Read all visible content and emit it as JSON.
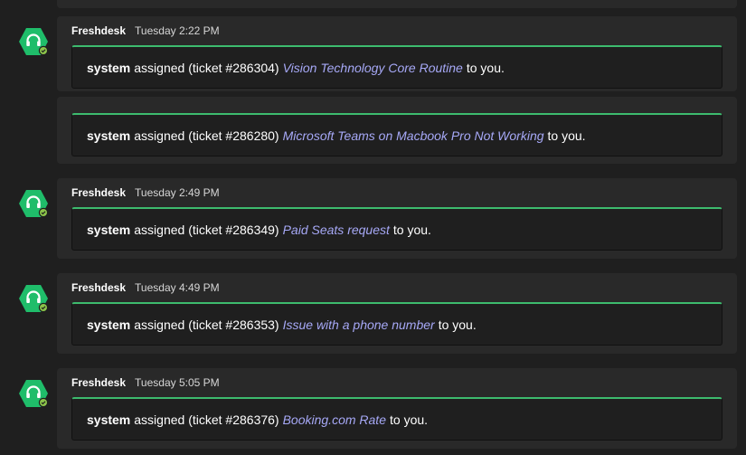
{
  "app": {
    "accent": "#3dbb6e",
    "link_color": "#a6a8f6",
    "avatar_color": "#1fbd6a"
  },
  "messages": [
    {
      "sender": "Freshdesk",
      "time": "Tuesday 2:22 PM",
      "notices": [
        {
          "actor": "system",
          "before": "assigned (ticket #286304)",
          "link": "Vision Technology Core Routine",
          "after": "to you."
        },
        {
          "actor": "system",
          "before": "assigned (ticket #286280)",
          "link": "Microsoft Teams on Macbook Pro Not Working",
          "after": "to you."
        }
      ]
    },
    {
      "sender": "Freshdesk",
      "time": "Tuesday 2:49 PM",
      "notices": [
        {
          "actor": "system",
          "before": "assigned (ticket #286349)",
          "link": "Paid Seats request",
          "after": "to you."
        }
      ]
    },
    {
      "sender": "Freshdesk",
      "time": "Tuesday 4:49 PM",
      "notices": [
        {
          "actor": "system",
          "before": "assigned (ticket #286353)",
          "link": "Issue with a phone number",
          "after": "to you."
        }
      ]
    },
    {
      "sender": "Freshdesk",
      "time": "Tuesday 5:05 PM",
      "notices": [
        {
          "actor": "system",
          "before": "assigned (ticket #286376)",
          "link": "Booking.com Rate",
          "after": "to you."
        }
      ]
    }
  ]
}
